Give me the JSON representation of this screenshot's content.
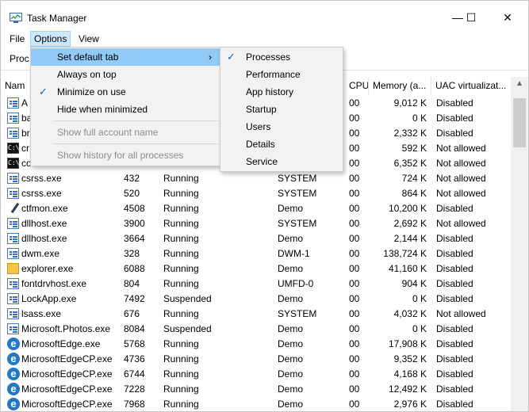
{
  "window": {
    "title": "Task Manager",
    "controls": {
      "minimize": "—",
      "maximize": "☐",
      "close": "✕"
    }
  },
  "menubar": {
    "file": "File",
    "options": "Options",
    "view": "View"
  },
  "tabstrip": {
    "partial_tab": "Proc"
  },
  "columns": {
    "name": "Nam",
    "cpu": "CPU",
    "memory": "Memory (a...",
    "uac": "UAC virtualizat..."
  },
  "rows": [
    {
      "icon": "app-icon",
      "name": "A",
      "pid": "",
      "status": "",
      "user": "",
      "cpu": "00",
      "memory": "9,012 K",
      "uac": "Disabled"
    },
    {
      "icon": "app-icon",
      "name": "ba",
      "pid": "",
      "status": "",
      "user": "",
      "cpu": "00",
      "memory": "0 K",
      "uac": "Disabled"
    },
    {
      "icon": "app-icon",
      "name": "br",
      "pid": "",
      "status": "",
      "user": "",
      "cpu": "00",
      "memory": "2,332 K",
      "uac": "Disabled"
    },
    {
      "icon": "cmd-icon",
      "name": "cr",
      "pid": "",
      "status": "",
      "user": "",
      "cpu": "00",
      "memory": "592 K",
      "uac": "Not allowed"
    },
    {
      "icon": "cmd-icon",
      "name": "co",
      "pid": "",
      "status": "",
      "user": "",
      "cpu": "00",
      "memory": "6,352 K",
      "uac": "Not allowed"
    },
    {
      "icon": "app-icon",
      "name": "csrss.exe",
      "pid": "432",
      "status": "Running",
      "user": "SYSTEM",
      "cpu": "00",
      "memory": "724 K",
      "uac": "Not allowed"
    },
    {
      "icon": "app-icon",
      "name": "csrss.exe",
      "pid": "520",
      "status": "Running",
      "user": "SYSTEM",
      "cpu": "00",
      "memory": "864 K",
      "uac": "Not allowed"
    },
    {
      "icon": "pen-icon",
      "name": "ctfmon.exe",
      "pid": "4508",
      "status": "Running",
      "user": "Demo",
      "cpu": "00",
      "memory": "10,200 K",
      "uac": "Disabled"
    },
    {
      "icon": "app-icon",
      "name": "dllhost.exe",
      "pid": "3900",
      "status": "Running",
      "user": "SYSTEM",
      "cpu": "00",
      "memory": "2,692 K",
      "uac": "Not allowed"
    },
    {
      "icon": "app-icon",
      "name": "dllhost.exe",
      "pid": "3664",
      "status": "Running",
      "user": "Demo",
      "cpu": "00",
      "memory": "2,144 K",
      "uac": "Disabled"
    },
    {
      "icon": "app-icon",
      "name": "dwm.exe",
      "pid": "328",
      "status": "Running",
      "user": "DWM-1",
      "cpu": "00",
      "memory": "138,724 K",
      "uac": "Disabled"
    },
    {
      "icon": "folder-icon",
      "name": "explorer.exe",
      "pid": "6088",
      "status": "Running",
      "user": "Demo",
      "cpu": "00",
      "memory": "41,160 K",
      "uac": "Disabled"
    },
    {
      "icon": "app-icon",
      "name": "fontdrvhost.exe",
      "pid": "804",
      "status": "Running",
      "user": "UMFD-0",
      "cpu": "00",
      "memory": "904 K",
      "uac": "Disabled"
    },
    {
      "icon": "app-icon",
      "name": "LockApp.exe",
      "pid": "7492",
      "status": "Suspended",
      "user": "Demo",
      "cpu": "00",
      "memory": "0 K",
      "uac": "Disabled"
    },
    {
      "icon": "app-icon",
      "name": "lsass.exe",
      "pid": "676",
      "status": "Running",
      "user": "SYSTEM",
      "cpu": "00",
      "memory": "4,032 K",
      "uac": "Not allowed"
    },
    {
      "icon": "app-icon",
      "name": "Microsoft.Photos.exe",
      "pid": "8084",
      "status": "Suspended",
      "user": "Demo",
      "cpu": "00",
      "memory": "0 K",
      "uac": "Disabled"
    },
    {
      "icon": "edge-icon",
      "name": "MicrosoftEdge.exe",
      "pid": "5768",
      "status": "Running",
      "user": "Demo",
      "cpu": "00",
      "memory": "17,908 K",
      "uac": "Disabled"
    },
    {
      "icon": "edge-icon",
      "name": "MicrosoftEdgeCP.exe",
      "pid": "4736",
      "status": "Running",
      "user": "Demo",
      "cpu": "00",
      "memory": "9,352 K",
      "uac": "Disabled"
    },
    {
      "icon": "edge-icon",
      "name": "MicrosoftEdgeCP.exe",
      "pid": "6744",
      "status": "Running",
      "user": "Demo",
      "cpu": "00",
      "memory": "4,168 K",
      "uac": "Disabled"
    },
    {
      "icon": "edge-icon",
      "name": "MicrosoftEdgeCP.exe",
      "pid": "7228",
      "status": "Running",
      "user": "Demo",
      "cpu": "00",
      "memory": "12,492 K",
      "uac": "Disabled"
    },
    {
      "icon": "edge-icon",
      "name": "MicrosoftEdgeCP.exe",
      "pid": "7968",
      "status": "Running",
      "user": "Demo",
      "cpu": "00",
      "memory": "2,976 K",
      "uac": "Disabled"
    }
  ],
  "options_menu": {
    "items": [
      {
        "label": "Set default tab",
        "checked": false,
        "disabled": false,
        "submenu": true,
        "highlighted": true
      },
      {
        "label": "Always on top",
        "checked": false,
        "disabled": false
      },
      {
        "label": "Minimize on use",
        "checked": true,
        "disabled": false
      },
      {
        "label": "Hide when minimized",
        "checked": false,
        "disabled": false
      },
      {
        "label": "Show full account name",
        "checked": false,
        "disabled": true
      },
      {
        "label": "Show history for all processes",
        "checked": false,
        "disabled": true
      }
    ],
    "check_glyph": "✓",
    "submenu_arrow": "›"
  },
  "default_tab_submenu": {
    "items": [
      {
        "label": "Processes",
        "checked": true
      },
      {
        "label": "Performance",
        "checked": false
      },
      {
        "label": "App history",
        "checked": false
      },
      {
        "label": "Startup",
        "checked": false
      },
      {
        "label": "Users",
        "checked": false
      },
      {
        "label": "Details",
        "checked": false
      },
      {
        "label": "Service",
        "checked": false
      }
    ]
  },
  "colors": {
    "menu_highlight": "#91c9f7",
    "menu_bg": "#f2f2f2",
    "check": "#1e5fa6",
    "active_menu": "#cce8ff"
  }
}
